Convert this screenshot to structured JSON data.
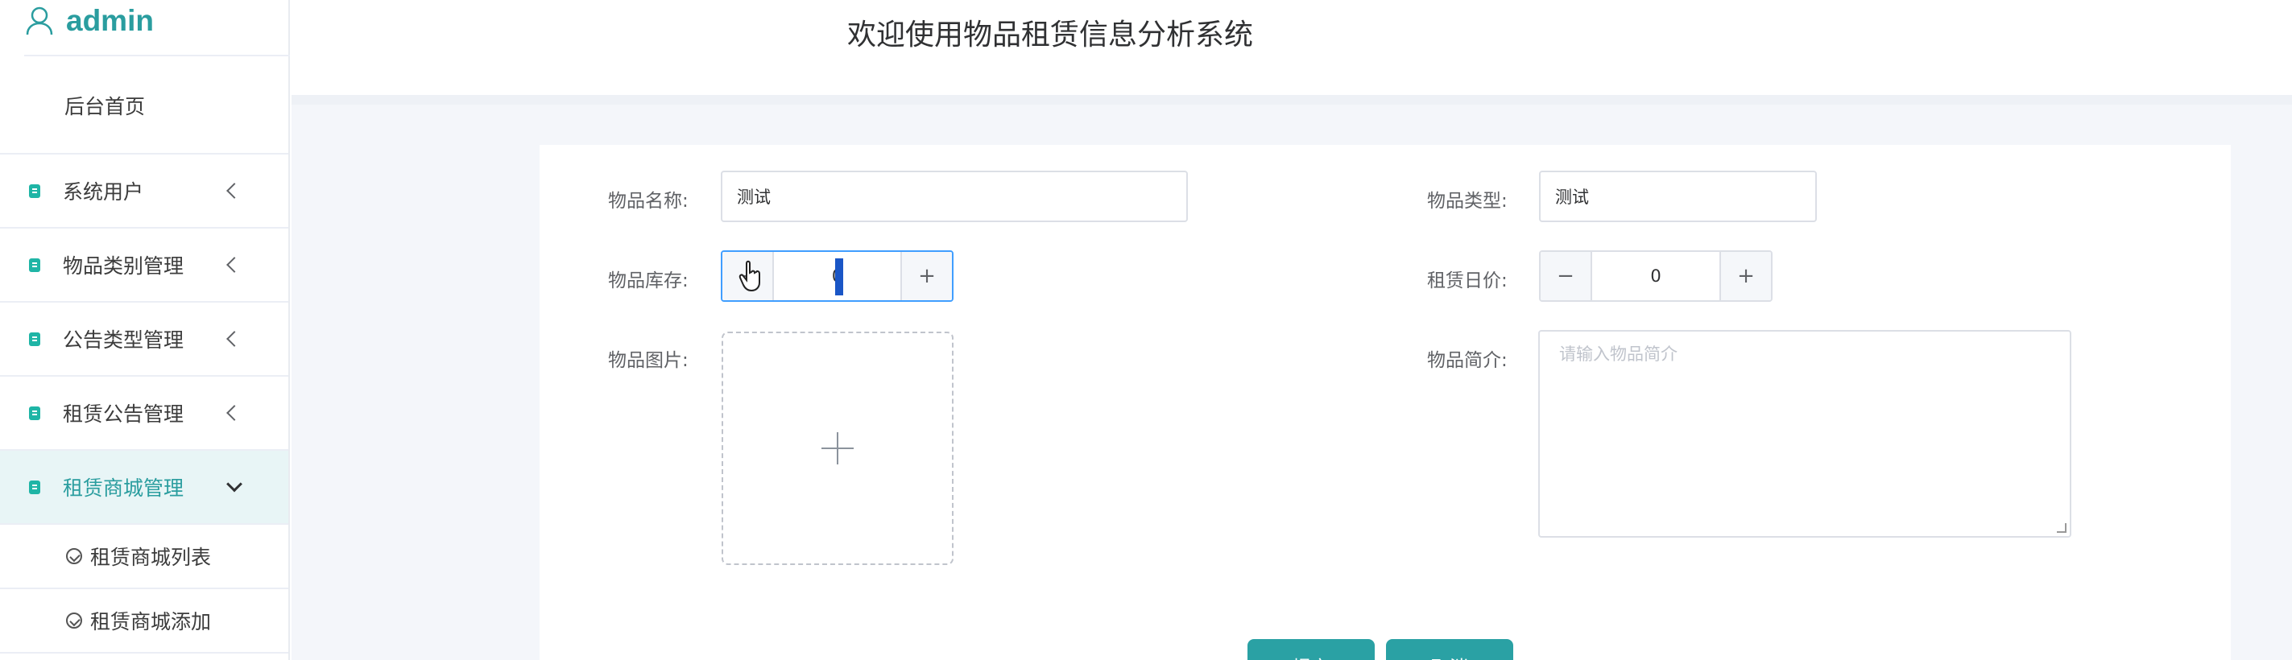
{
  "user": {
    "name": "admin",
    "icon": "user-icon"
  },
  "header": {
    "title": "欢迎使用物品租赁信息分析系统"
  },
  "sidebar": {
    "home": "后台首页",
    "items": [
      {
        "label": "系统用户"
      },
      {
        "label": "物品类别管理"
      },
      {
        "label": "公告类型管理"
      },
      {
        "label": "租赁公告管理"
      },
      {
        "label": "租赁商城管理"
      }
    ],
    "subitems": [
      {
        "label": "租赁商城列表"
      },
      {
        "label": "租赁商城添加"
      }
    ]
  },
  "form": {
    "name_label": "物品名称:",
    "name_value": "测试",
    "type_label": "物品类型:",
    "type_value": "测试",
    "stock_label": "物品库存:",
    "stock_value": "0",
    "price_label": "租赁日价:",
    "price_value": "0",
    "image_label": "物品图片:",
    "intro_label": "物品简介:",
    "intro_placeholder": "请输入物品简介",
    "submit_label": "提交",
    "cancel_label": "取消"
  },
  "colors": {
    "accent": "#2aa1a4",
    "focus": "#409eff"
  }
}
